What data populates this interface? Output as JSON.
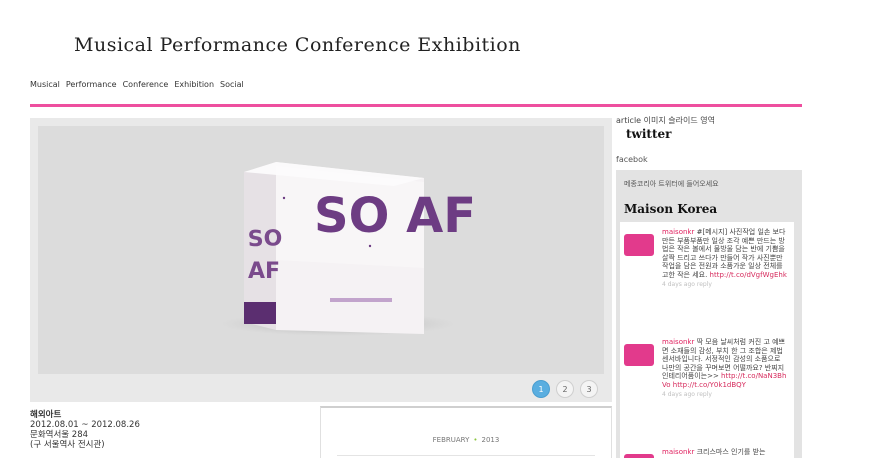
{
  "header": {
    "title": "Musical Performance Conference Exhibition",
    "nav": [
      "Musical",
      "Performance",
      "Conference",
      "Exhibition",
      "Social"
    ]
  },
  "slider": {
    "pages": [
      "1",
      "2",
      "3"
    ],
    "active_page": 1,
    "cover_large": "SO AF",
    "cover_spine": "SO AF"
  },
  "event": {
    "title": "해외아트",
    "dates": "2012.08.01 ~ 2012.08.26",
    "venue": "문화역서울 284",
    "extra": "(구 서울역사 전시관)"
  },
  "calendar": {
    "month": "FEBRUARY",
    "year": "2013"
  },
  "sidebar": {
    "article": "article 이미지 슬라이드 영역",
    "twitter_heading": "twitter",
    "facebook_label": "facebok",
    "widget_head": "메종코리아 트위터에 들어오세요",
    "widget_title": "Maison Korea",
    "tweets": [
      {
        "user": "maisonkr",
        "text": "#[메시지] 사진작업 일손 보다 만든 부품부품만 일상 조각 예쁜 만드는 방법은 작은 볼에서 물방울 담는 반에 기쁨을 살짝 드리고 쓰다가 만들어 작가 사진뿐만 작업을 담은 전원과 소품가운 일상 전체를 고한 작은 세요. ",
        "link": "http://t.co/dVgfWgEhk",
        "meta": "4 days ago reply"
      },
      {
        "user": "maisonkr",
        "text": " 딱 모음 날씨처럼 커진 고 예쁘면 소재들의 감성, 부치 한 그 조합은 제법 센서바입니다. 서정적인 감성의 소품으로 나만의 공간을 꾸며보면 어떨까요? 반찌지 인테리어품이는>>",
        "link": "http://t.co/NaN3BhVo http://t.co/Y0k1dBQY",
        "meta": "4 days ago reply"
      },
      {
        "user": "maisonkr",
        "text": " 크리스마스 인기를 받는",
        "link": "",
        "meta": ""
      }
    ]
  }
}
